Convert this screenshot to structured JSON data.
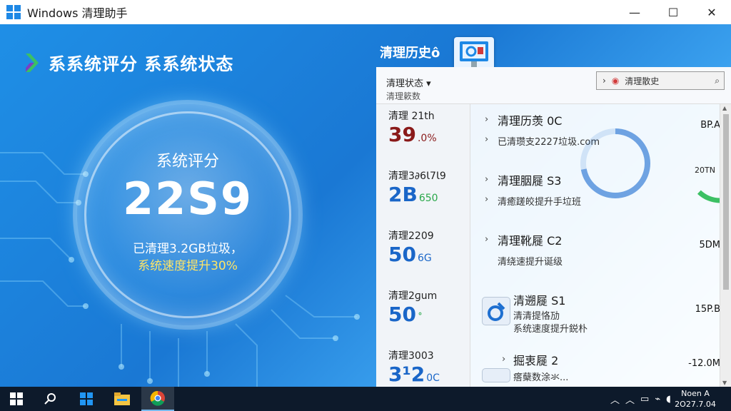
{
  "window": {
    "title": "Windows 清理助手",
    "minimize": "—",
    "maximize": "☐",
    "close": "✕"
  },
  "header": {
    "title": "系系统评分 系系统状态"
  },
  "score": {
    "label": "系统评分",
    "value": "22S9",
    "line1": "已清理3.2GB垃圾，",
    "line2": "系统速度提升30%"
  },
  "history": {
    "title": "清理历史ô"
  },
  "panel": {
    "status_dropdown": "清理状态 ▾",
    "status_sub": "清理簌数",
    "search_text": "清理散史",
    "left_items": [
      {
        "label": "清理 21th",
        "value": "39",
        "unit": ".0%",
        "color": "#8a1a1a"
      },
      {
        "label": "清理3∂6Ɩ7Ɩ9",
        "value": "2B",
        "unit": "650",
        "color": "#1a66c8",
        "unit_color": "#2aa84a"
      },
      {
        "label": "清理2209",
        "value": "50",
        "unit": "6G",
        "color": "#1a66c8"
      },
      {
        "label": "清理2ɡum",
        "value": "50",
        "unit": "˚",
        "color": "#1a66c8",
        "unit_color": "#2aa84a"
      },
      {
        "label": "清理3003",
        "value": "3¹2",
        "unit": "0C",
        "color": "#1a66c8"
      }
    ],
    "rows": [
      {
        "title": "清理历羡 0C",
        "sub": "已清瓒支2227垃圾.com",
        "size": "BP.A"
      },
      {
        "title": "清理胭屣 S3",
        "sub": "清癒蹉皎提升手垃班",
        "size": "20TN"
      },
      {
        "title": "清理靴屣 C2",
        "sub": "清绕速提升诞级",
        "size": "5DM"
      },
      {
        "title": "清遡屣 S1",
        "sub": "清清提恪劢",
        "sub2": "系统速度提升鋭朴",
        "size": "15P.B"
      },
      {
        "title": "掘衷屣 2",
        "sub": "瘩蘖数涂氺...",
        "size": "-12.0M"
      }
    ],
    "ring_value": 0.72,
    "green_ring_value": 0.62
  },
  "taskbar": {
    "clock_time": "Noen A",
    "clock_date": "2O27.7.04"
  },
  "colors": {
    "accent": "#1a7fd6",
    "warning_text": "#ffe566",
    "green": "#3cc064"
  }
}
